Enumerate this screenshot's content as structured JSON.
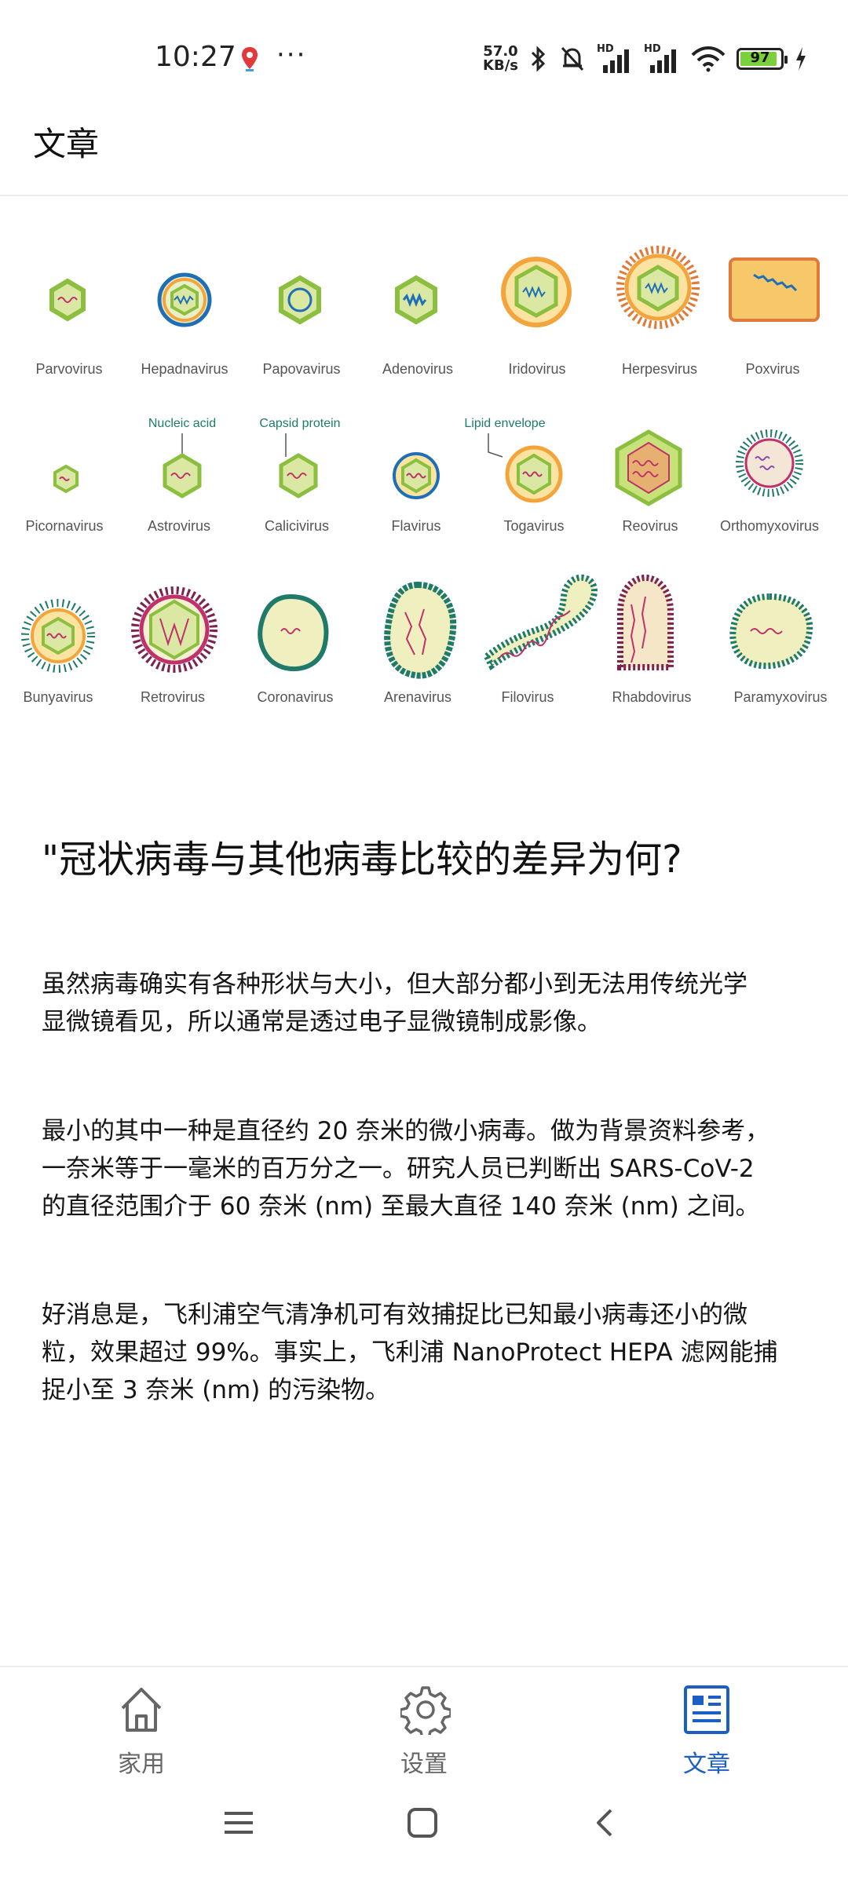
{
  "status_bar": {
    "time": "10:27",
    "more": "···",
    "net_speed_value": "57.0",
    "net_speed_unit": "KB/s",
    "hd1": "HD",
    "hd2": "HD",
    "battery": "97"
  },
  "header": {
    "title": "文章"
  },
  "figure": {
    "row1": [
      "Parvovirus",
      "Hepadnavirus",
      "Papovavirus",
      "Adenovirus",
      "Iridovirus",
      "Herpesvirus",
      "Poxvirus"
    ],
    "row2": [
      "Picornavirus",
      "Astrovirus",
      "Calicivirus",
      "Flavirus",
      "Togavirus",
      "Reovirus",
      "Orthomyxovirus"
    ],
    "row3": [
      "Bunyavirus",
      "Retrovirus",
      "Coronavirus",
      "Arenavirus",
      "Filovirus",
      "Rhabdovirus",
      "Paramyxovirus"
    ],
    "annotations": {
      "nucleic_acid": "Nucleic acid",
      "capsid_protein": "Capsid protein",
      "lipid_envelope": "Lipid envelope"
    }
  },
  "article": {
    "heading": "\"冠状病毒与其他病毒比较的差异为何?",
    "paragraphs": [
      [
        "虽然病毒确实有各种形状与大小，但大部分都小到无法用传统光学",
        "显微镜看见，所以通常是透过电子显微镜制成影像。"
      ],
      [
        "最小的其中一种是直径约 20 奈米的微小病毒。做为背景资料参考，",
        "一奈米等于一毫米的百万分之一。研究人员已判断出 SARS-CoV-2",
        "的直径范围介于 60 奈米 (nm) 至最大直径 140 奈米 (nm) 之间。"
      ],
      [
        "好消息是，飞利浦空气清净机可有效捕捉比已知最小病毒还小的微",
        "粒，效果超过 99%。事实上，飞利浦 NanoProtect HEPA 滤网能捕",
        "捉小至 3 奈米 (nm) 的污染物。"
      ]
    ]
  },
  "tab_bar": {
    "tabs": [
      {
        "label": "家用",
        "icon": "home-icon"
      },
      {
        "label": "设置",
        "icon": "gear-icon"
      },
      {
        "label": "文章",
        "icon": "article-icon",
        "active": true
      }
    ],
    "active_color": "#1b5fc4"
  },
  "nav_bar": {
    "icons": [
      "menu-icon",
      "home-square-icon",
      "back-icon"
    ]
  },
  "colors": {
    "capsid_green": "#8cbf3f",
    "nucleic_red": "#c0306a",
    "envelope_orange": "#f3a53c",
    "spike_teal": "#1f7a6a"
  }
}
